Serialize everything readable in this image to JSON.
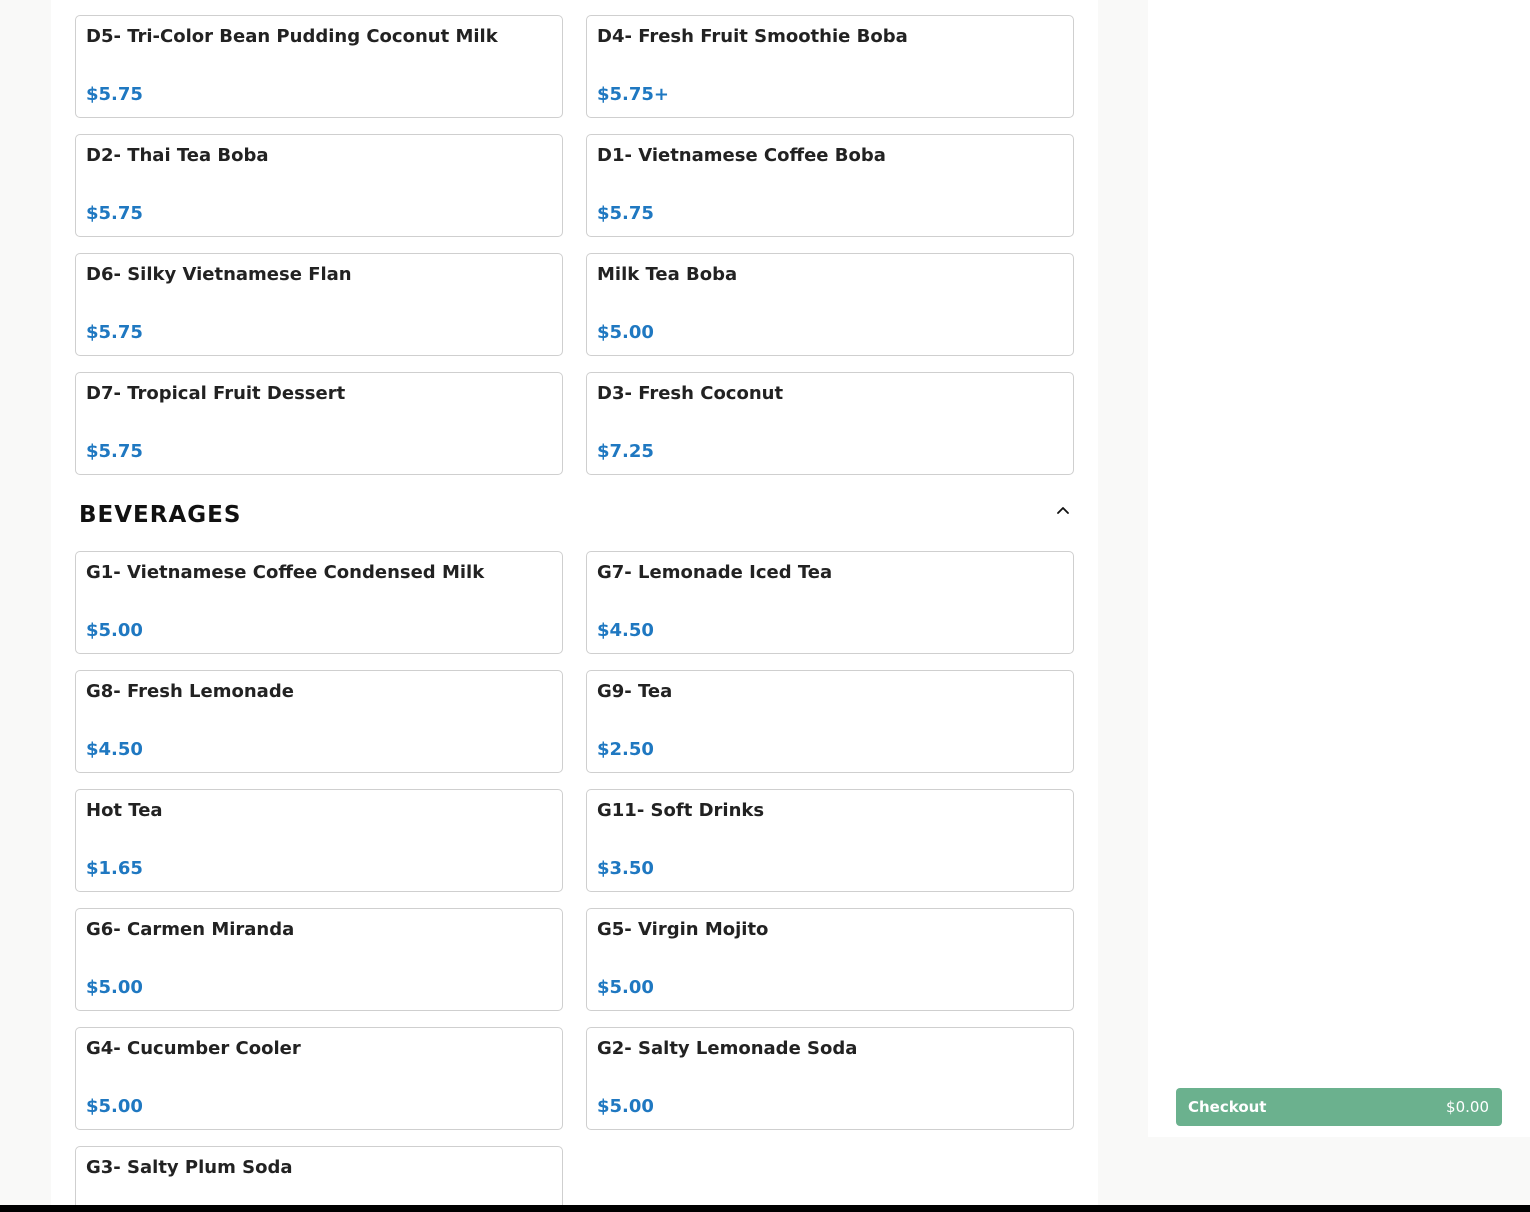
{
  "desserts": {
    "items": [
      {
        "name": "D5- Tri-Color Bean Pudding Coconut Milk",
        "price": "$5.75"
      },
      {
        "name": "D4- Fresh Fruit Smoothie Boba",
        "price": "$5.75+"
      },
      {
        "name": "D2- Thai Tea Boba",
        "price": "$5.75"
      },
      {
        "name": "D1- Vietnamese Coffee Boba",
        "price": "$5.75"
      },
      {
        "name": "D6- Silky Vietnamese Flan",
        "price": "$5.75"
      },
      {
        "name": "Milk Tea Boba",
        "price": "$5.00"
      },
      {
        "name": "D7- Tropical Fruit Dessert",
        "price": "$5.75"
      },
      {
        "name": "D3- Fresh Coconut",
        "price": "$7.25"
      }
    ]
  },
  "beverages": {
    "title": "BEVERAGES",
    "collapse_icon": "chevron-up-icon",
    "items": [
      {
        "name": "G1- Vietnamese Coffee Condensed Milk",
        "price": "$5.00"
      },
      {
        "name": "G7- Lemonade Iced Tea",
        "price": "$4.50"
      },
      {
        "name": "G8- Fresh Lemonade",
        "price": "$4.50"
      },
      {
        "name": "G9- Tea",
        "price": "$2.50"
      },
      {
        "name": "Hot Tea",
        "price": "$1.65"
      },
      {
        "name": "G11- Soft Drinks",
        "price": "$3.50"
      },
      {
        "name": "G6- Carmen Miranda",
        "price": "$5.00"
      },
      {
        "name": "G5- Virgin Mojito",
        "price": "$5.00"
      },
      {
        "name": "G4- Cucumber Cooler",
        "price": "$5.00"
      },
      {
        "name": "G2- Salty Lemonade Soda",
        "price": "$5.00"
      },
      {
        "name": "G3- Salty Plum Soda",
        "price": ""
      }
    ]
  },
  "cart": {
    "checkout_label": "Checkout",
    "total": "$0.00"
  },
  "colors": {
    "price": "#1f78c1",
    "checkout": "#6bb18e"
  }
}
